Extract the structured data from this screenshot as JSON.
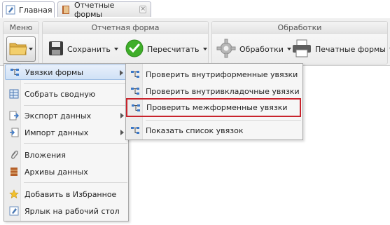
{
  "tabs": [
    {
      "label": "Главная",
      "icon": "edit-icon"
    },
    {
      "label": "Отчетные формы",
      "icon": "book-icon",
      "close": "×"
    }
  ],
  "ribbon": {
    "menu_group": {
      "title": "Меню"
    },
    "form_group": {
      "title": "Отчетная форма",
      "save_label": "Сохранить",
      "recalc_label": "Пересчитать"
    },
    "proc_group": {
      "title": "Обработки",
      "proc_label": "Обработки",
      "print_label": "Печатные формы"
    }
  },
  "menu": {
    "items": [
      {
        "label": "Увязки формы",
        "icon": "links-icon",
        "submenu": true
      },
      {
        "label": "Собрать сводную",
        "icon": "table-icon"
      },
      {
        "label": "Экспорт данных",
        "icon": "export-icon",
        "submenu": true
      },
      {
        "label": "Импорт данных",
        "icon": "import-icon",
        "submenu": true
      },
      {
        "label": "Вложения",
        "icon": "paperclip-icon"
      },
      {
        "label": "Архивы данных",
        "icon": "archive-icon"
      },
      {
        "label": "Добавить в Избранное",
        "icon": "star-icon"
      },
      {
        "label": "Ярлык на рабочий стол",
        "icon": "shortcut-icon"
      }
    ]
  },
  "submenu": {
    "items": [
      {
        "label": "Проверить внутриформенные увязки",
        "icon": "links-icon"
      },
      {
        "label": "Проверить внутривкладочные увязки",
        "icon": "links-icon"
      },
      {
        "label": "Проверить межформенные увязки",
        "icon": "links-icon"
      },
      {
        "label": "Показать список увязок",
        "icon": "links-icon"
      }
    ]
  },
  "colors": {
    "highlight_border": "#c8232c",
    "hover_bg": "#d0e1f6",
    "accent_green": "#3fae2a"
  }
}
